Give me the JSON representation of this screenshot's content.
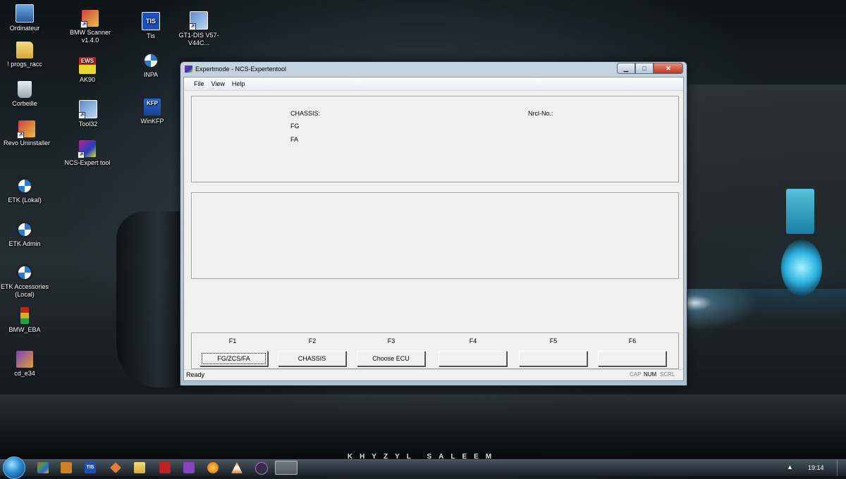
{
  "desktop_icons": [
    {
      "label": "Ordinateur"
    },
    {
      "label": "! progs_racc"
    },
    {
      "label": "Corbeille"
    },
    {
      "label": "Revo Uninstaller"
    },
    {
      "label": "ETK (Lokal)"
    },
    {
      "label": "ETK Admin"
    },
    {
      "label": "ETK Accessories (Local)"
    },
    {
      "label": "BMW_EBA"
    },
    {
      "label": "cd_e34"
    },
    {
      "label": "BMW Scanner v1.4.0"
    },
    {
      "label": "AK90",
      "glyph": "EWS"
    },
    {
      "label": "Tool32"
    },
    {
      "label": "NCS-Expert tool"
    },
    {
      "label": "Tis",
      "glyph": "TIS"
    },
    {
      "label": "INPA"
    },
    {
      "label": "WinKFP",
      "glyph": "KFP"
    },
    {
      "label": "GT1-DIS V57-V44C..."
    }
  ],
  "window": {
    "title": "Expertmode - NCS-Expertentool",
    "menu": [
      "File",
      "View",
      "Help"
    ],
    "info": {
      "chassis_label": "CHASSIS:",
      "fg_label": "FG",
      "fa_label": "FA",
      "nrcl_label": "Nrcl-No.:"
    },
    "fkeys": [
      {
        "key": "F1",
        "button": "FG/ZCS/FA"
      },
      {
        "key": "F2",
        "button": "CHASSIS"
      },
      {
        "key": "F3",
        "button": "Choose ECU"
      },
      {
        "key": "F4",
        "button": ""
      },
      {
        "key": "F5",
        "button": ""
      },
      {
        "key": "F6",
        "button": ""
      }
    ],
    "status": "Ready",
    "indicators": {
      "cap": "CAP",
      "num": "NUM",
      "scrl": "SCRL"
    }
  },
  "wallpaper_text": "KHYZYL SALEEM",
  "taskbar": {
    "clock": "19:14",
    "tray_arrow": "▲",
    "active_glyph": "TIS"
  }
}
